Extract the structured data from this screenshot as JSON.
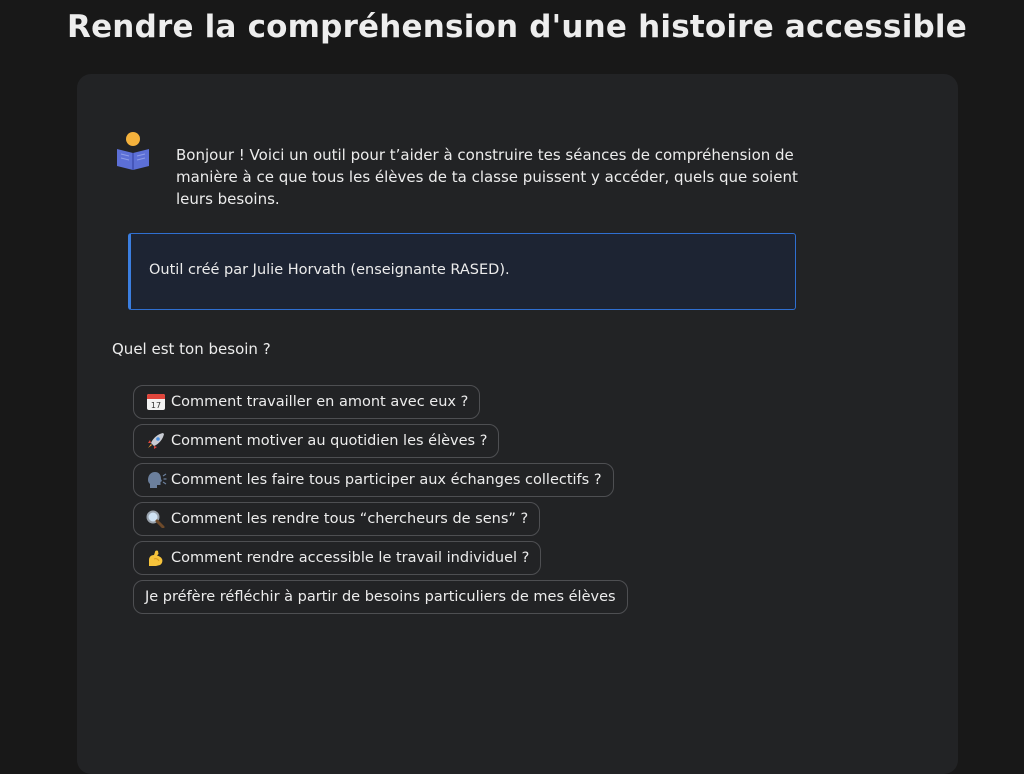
{
  "page": {
    "title": "Rendre la compréhension d'une histoire accessible"
  },
  "assistant": {
    "avatar_icon": "reading-person-icon",
    "intro": "Bonjour ! Voici un outil pour t’aider à construire tes séances de compréhension de manière à ce que tous les élèves de ta classe puissent y accéder, quels que soient leurs besoins."
  },
  "callout": {
    "text": "Outil créé par Julie Horvath (enseignante RASED).",
    "accent_color": "#3b7ee0"
  },
  "question": "Quel est ton besoin ?",
  "options": [
    {
      "icon": "calendar-icon",
      "label": "Comment travailler en amont avec eux ?"
    },
    {
      "icon": "rocket-icon",
      "label": "Comment motiver au quotidien les élèves ?"
    },
    {
      "icon": "speaking-head-icon",
      "label": "Comment les faire tous participer aux échanges collectifs ?"
    },
    {
      "icon": "magnifier-icon",
      "label": "Comment les rendre tous “chercheurs de sens” ?"
    },
    {
      "icon": "flexed-biceps-icon",
      "label": "Comment rendre accessible le travail individuel ?"
    },
    {
      "icon": "",
      "label": "Je préfère réfléchir à partir de besoins particuliers de mes élèves"
    }
  ]
}
